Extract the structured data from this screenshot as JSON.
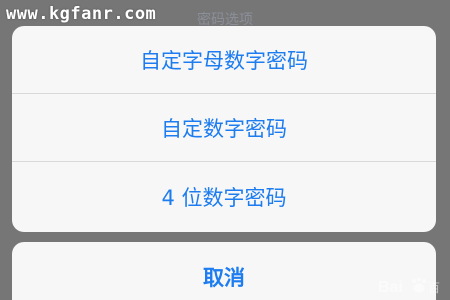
{
  "overlay": {
    "watermark_text": "www.kgfanr.com"
  },
  "sheet": {
    "title": "密码选项",
    "options": [
      {
        "label": "自定字母数字密码"
      },
      {
        "label": "自定数字密码"
      },
      {
        "label": "4 位数字密码"
      }
    ],
    "cancel_label": "取消"
  },
  "icons": {
    "baidu_logo": "baidu-logo-icon"
  },
  "colors": {
    "background_dim": "#767676",
    "sheet_bg": "#f7f7f7",
    "accent_blue": "#1c7cf0",
    "title_gray": "#8a8f99",
    "separator": "#d9d9d9"
  }
}
